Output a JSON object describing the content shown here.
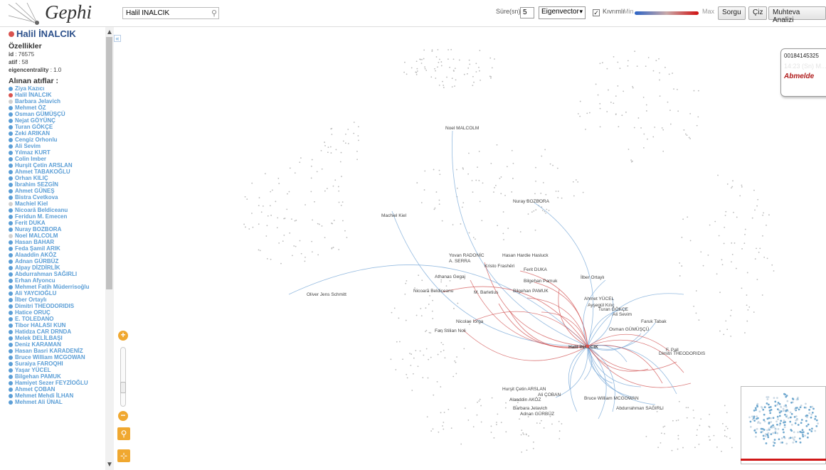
{
  "app": {
    "logo_text": "Gephi"
  },
  "search": {
    "value": "Halil İNALCIK"
  },
  "controls": {
    "duration_label": "Süre(sn):",
    "duration_value": "5",
    "metric_value": "Eigenvector",
    "curved_label": "Kıvrımlı",
    "curved_checked": true,
    "legend_min": "Min",
    "legend_max": "Max",
    "query_button": "Sorgu",
    "draw_button": "Çiz",
    "content_analysis_button": "Muhteva Analizi"
  },
  "node": {
    "title": "Halil İNALCIK",
    "properties_heading": "Özellikler",
    "properties": [
      {
        "key": "id",
        "value": "76575"
      },
      {
        "key": "atif",
        "value": "58"
      },
      {
        "key": "eigencentrality",
        "value": "1.0"
      }
    ],
    "citations_heading": "Alınan atıflar :",
    "citations": [
      {
        "name": "Ziya Kazıcı",
        "color": "#5b9ed6"
      },
      {
        "name": "Halil İNALCIK",
        "color": "#d9534f"
      },
      {
        "name": "Barbara Jelavich",
        "color": "#cfcfcf"
      },
      {
        "name": "Mehmet ÖZ",
        "color": "#5b9ed6"
      },
      {
        "name": "Osman GÜMÜŞÇÜ",
        "color": "#5b9ed6"
      },
      {
        "name": "Nejat GÖYÜNÇ",
        "color": "#5b9ed6"
      },
      {
        "name": "Turan GÖKÇE",
        "color": "#5b9ed6"
      },
      {
        "name": "Zeki ARIKAN",
        "color": "#5b9ed6"
      },
      {
        "name": "Cengiz Orhonlu",
        "color": "#5b9ed6"
      },
      {
        "name": "Ali Sevim",
        "color": "#5b9ed6"
      },
      {
        "name": "Yılmaz KURT",
        "color": "#5b9ed6"
      },
      {
        "name": "Colin Imber",
        "color": "#5b9ed6"
      },
      {
        "name": "Hurşit Çetin ARSLAN",
        "color": "#5b9ed6"
      },
      {
        "name": "Ahmet TABAKOĞLU",
        "color": "#5b9ed6"
      },
      {
        "name": "Orhan KILIÇ",
        "color": "#5b9ed6"
      },
      {
        "name": "İbrahim SEZGİN",
        "color": "#5b9ed6"
      },
      {
        "name": "Ahmet GÜNEŞ",
        "color": "#5b9ed6"
      },
      {
        "name": "Bistra Cvetkova",
        "color": "#5b9ed6"
      },
      {
        "name": "Machiel Kiel",
        "color": "#cfcfcf"
      },
      {
        "name": "Nicoară Beldiceanu",
        "color": "#5b9ed6"
      },
      {
        "name": "Feridun M. Emecen",
        "color": "#5b9ed6"
      },
      {
        "name": "Ferit DUKA",
        "color": "#5b9ed6"
      },
      {
        "name": "Nuray BOZBORA",
        "color": "#5b9ed6"
      },
      {
        "name": "Noel MALCOLM",
        "color": "#cfcfcf"
      },
      {
        "name": "Hasan BAHAR",
        "color": "#5b9ed6"
      },
      {
        "name": "Feda Şamil ARIK",
        "color": "#5b9ed6"
      },
      {
        "name": "Alaaddin AKÖZ",
        "color": "#5b9ed6"
      },
      {
        "name": "Adnan GÜRBÜZ",
        "color": "#5b9ed6"
      },
      {
        "name": "Alpay DİZDİRLİK",
        "color": "#5b9ed6"
      },
      {
        "name": "Abdurrahman SAĞIRLI",
        "color": "#5b9ed6"
      },
      {
        "name": "Erhan Afyoncu",
        "color": "#5b9ed6"
      },
      {
        "name": "Mehmet Fatih Müderrisoğlu",
        "color": "#5b9ed6"
      },
      {
        "name": "Ali YAYCIOĞLU",
        "color": "#5b9ed6"
      },
      {
        "name": "İlber Ortaylı",
        "color": "#5b9ed6"
      },
      {
        "name": "Dimitri THEODORIDIS",
        "color": "#5b9ed6"
      },
      {
        "name": "Hatice ORUÇ",
        "color": "#5b9ed6"
      },
      {
        "name": "E. TOLEDANO",
        "color": "#5b9ed6"
      },
      {
        "name": "Tibor HALASI KUN",
        "color": "#5b9ed6"
      },
      {
        "name": "Hatidza CAR DRNDA",
        "color": "#5b9ed6"
      },
      {
        "name": "Melek DELİLBAŞI",
        "color": "#5b9ed6"
      },
      {
        "name": "Deniz KARAMAN",
        "color": "#5b9ed6"
      },
      {
        "name": "Hasan Basri KARADENİZ",
        "color": "#5b9ed6"
      },
      {
        "name": "Bruce William MCGOWAN",
        "color": "#5b9ed6"
      },
      {
        "name": "Suraiya FAROQHI",
        "color": "#5b9ed6"
      },
      {
        "name": "Yaşar YÜCEL",
        "color": "#5b9ed6"
      },
      {
        "name": "Bilgehan PAMUK",
        "color": "#5b9ed6"
      },
      {
        "name": "Hamiyet Sezer FEYZİOĞLU",
        "color": "#5b9ed6"
      },
      {
        "name": "Ahmet ÇOBAN",
        "color": "#5b9ed6"
      },
      {
        "name": "Mehmet Mehdi İLHAN",
        "color": "#5b9ed6"
      },
      {
        "name": "Mehmet Ali ÜNAL",
        "color": "#5b9ed6"
      }
    ]
  },
  "graph": {
    "center_label": "Halil İNALCIK",
    "labels": [
      "Noel MALCOLM",
      "Nuray BOZBORA",
      "Machiel Kiel",
      "Oliver Jens Schmitt",
      "Yovan RADONİC",
      "Hasan Hardie Hasluck",
      "A. SERRA",
      "Kristo Frashëri",
      "Ferit DUKA",
      "Athanas Gegaj",
      "İlber Ortaylı",
      "Bilgehan Pamuk",
      "Nicoară Beldiceanu",
      "M. Barletius",
      "Bilgehan PAMUK",
      "Ahmet YÜCEL",
      "Ayşegül Kılıç",
      "Turan GÖKÇE",
      "Ali Sevim",
      "Nicolae Iorga",
      "Faruk Tabak",
      "Fan Stilian Noli",
      "Osman GÜMÜŞÇÜ",
      "F. Pall",
      "Dimitri THEODORIDIS",
      "Hurşit Çetin ARSLAN",
      "Alaaddin AKÖZ",
      "Barbara Jelavich",
      "Adnan GÜRBÜZ",
      "Bruce William MCGOWAN",
      "Abdurrahman SAĞIRLI",
      "Ali ÇOBAN"
    ]
  },
  "infobox": {
    "id": "00184145325",
    "time": "14:23 (Sn) M...",
    "name": "Abmelde"
  },
  "icons": {
    "zoom_in": "zoom-in-icon",
    "zoom_out": "zoom-out-icon",
    "search_tool": "magnifier-icon",
    "center_tool": "center-icon"
  }
}
